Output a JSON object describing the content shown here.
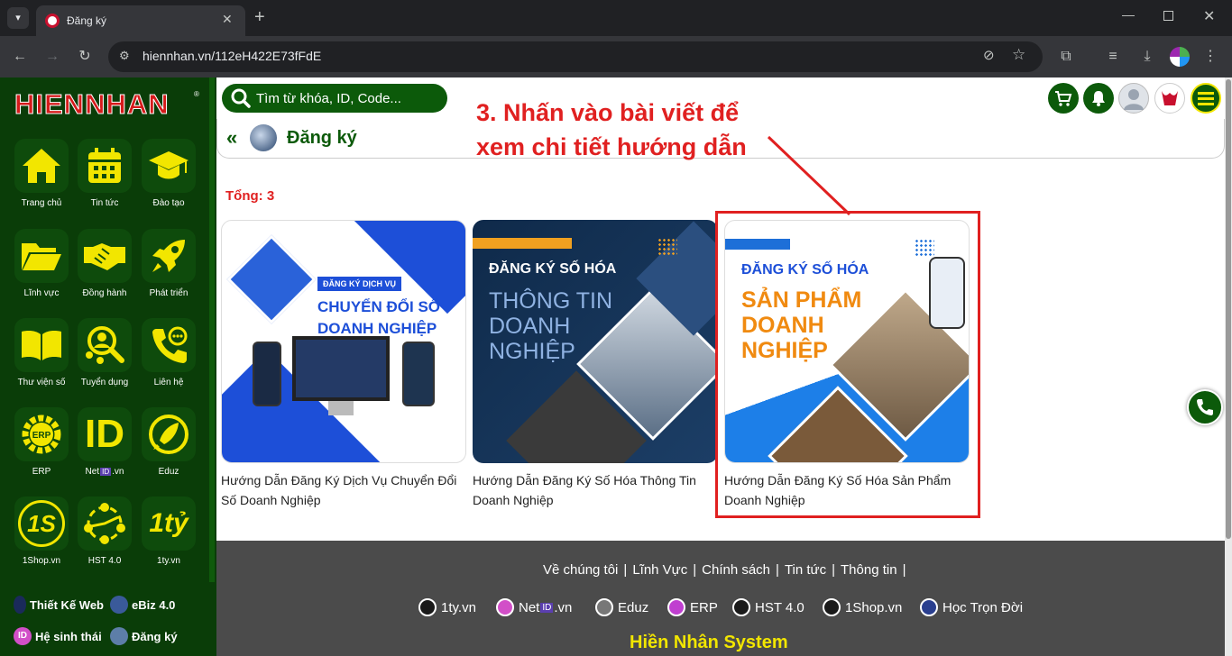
{
  "browser": {
    "tab_title": "Đăng ký",
    "url": "hiennhan.vn/112eH422E73fFdE"
  },
  "sidebar": {
    "logo": "HIENNHAN",
    "apps": [
      {
        "label": "Trang chủ",
        "icon": "home-icon"
      },
      {
        "label": "Tin tức",
        "icon": "calendar-icon"
      },
      {
        "label": "Đào tạo",
        "icon": "graduation-cap-icon"
      },
      {
        "label": "Lĩnh vực",
        "icon": "folder-icon"
      },
      {
        "label": "Đồng hành",
        "icon": "handshake-icon"
      },
      {
        "label": "Phát triển",
        "icon": "rocket-icon"
      },
      {
        "label": "Thư viện số",
        "icon": "book-icon"
      },
      {
        "label": "Tuyển dụng",
        "icon": "recruit-icon"
      },
      {
        "label": "Liên hệ",
        "icon": "phone-icon"
      },
      {
        "label": "ERP",
        "icon": "erp-gear-icon"
      },
      {
        "label": "Net",
        "label_badge": "ID",
        "label_suffix": ".vn",
        "icon": "id-icon",
        "icon_text": "ID"
      },
      {
        "label": "Eduz",
        "icon": "eduz-icon"
      },
      {
        "label": "1Shop.vn",
        "icon": "1shop-icon",
        "icon_text": "1S"
      },
      {
        "label": "HST 4.0",
        "icon": "network-icon"
      },
      {
        "label": "1ty.vn",
        "icon": "1ty-icon",
        "icon_text": "1tỷ"
      }
    ],
    "bottom_links": [
      {
        "label": "Thiết Kế Web",
        "icon": "web-icon"
      },
      {
        "label": "eBiz 4.0",
        "icon": "ebiz-icon"
      },
      {
        "label": "Hệ sinh thái",
        "icon": "id-badge-icon"
      },
      {
        "label": "Đăng ký",
        "icon": "register-icon"
      }
    ]
  },
  "header": {
    "search_placeholder": "Tìm từ khóa, ID, Code...",
    "breadcrumb_title": "Đăng ký",
    "annotation_line1": "3. Nhấn vào bài viết để",
    "annotation_line2": "xem chi tiết hướng dẫn"
  },
  "content": {
    "total_label": "Tổng: 3",
    "cards": [
      {
        "title": "Hướng Dẫn Đăng Ký Dịch Vụ Chuyển Đổi Số Doanh Nghiệp",
        "badge": "ĐĂNG KÝ DỊCH VỤ",
        "line1": "CHUYỂN ĐỔI SỐ",
        "line2": "DOANH NGHIỆP"
      },
      {
        "title": "Hướng Dẫn Đăng Ký Số Hóa Thông Tin Doanh Nghiệp",
        "heading": "ĐĂNG KÝ SỐ HÓA",
        "line1": "THÔNG TIN",
        "line2": "DOANH",
        "line3": "NGHIỆP"
      },
      {
        "title": "Hướng Dẫn Đăng Ký Số Hóa Sản Phẩm Doanh Nghiệp",
        "heading": "ĐĂNG KÝ SỐ HÓA",
        "line1": "SẢN PHẨM",
        "line2": "DOANH",
        "line3": "NGHIỆP"
      }
    ]
  },
  "footer": {
    "links": [
      "Về chúng tôi",
      "Lĩnh Vực",
      "Chính sách",
      "Tin tức",
      "Thông tin"
    ],
    "sites": [
      {
        "label": "1ty.vn"
      },
      {
        "label": "Net",
        "badge": "ID",
        "suffix": ".vn"
      },
      {
        "label": "Eduz"
      },
      {
        "label": "ERP"
      },
      {
        "label": "HST 4.0"
      },
      {
        "label": "1Shop.vn"
      },
      {
        "label": "Học Trọn Đời"
      }
    ],
    "brand": "Hiền Nhân System"
  },
  "colors": {
    "sidebar_bg": "#0a3d08",
    "accent_green": "#0c5a0a",
    "accent_yellow": "#f2e600",
    "brand_red": "#c8102e",
    "highlight_red": "#e02020"
  }
}
